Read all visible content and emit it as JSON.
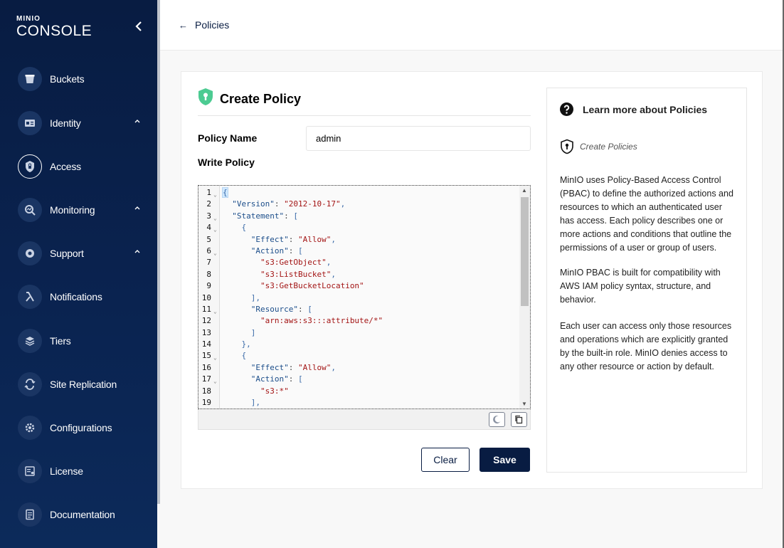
{
  "app": {
    "logo_top": "MINIO",
    "logo_main": "CONSOLE"
  },
  "sidebar": {
    "items": [
      {
        "label": "Buckets",
        "icon": "bucket-icon"
      },
      {
        "label": "Identity",
        "icon": "id-card-icon",
        "expandable": true
      },
      {
        "label": "Access",
        "icon": "lock-shield-icon",
        "active": true
      },
      {
        "label": "Monitoring",
        "icon": "monitoring-icon",
        "expandable": true
      },
      {
        "label": "Support",
        "icon": "support-icon",
        "expandable": true
      },
      {
        "label": "Notifications",
        "icon": "lambda-icon"
      },
      {
        "label": "Tiers",
        "icon": "layers-icon"
      },
      {
        "label": "Site Replication",
        "icon": "replication-icon"
      },
      {
        "label": "Configurations",
        "icon": "gear-icon"
      },
      {
        "label": "License",
        "icon": "license-icon"
      },
      {
        "label": "Documentation",
        "icon": "document-icon"
      }
    ]
  },
  "header": {
    "back_label": "Policies"
  },
  "form": {
    "title": "Create Policy",
    "policy_name_label": "Policy Name",
    "policy_name_value": "admin",
    "write_policy_label": "Write Policy",
    "clear_label": "Clear",
    "save_label": "Save"
  },
  "editor": {
    "lines": [
      {
        "n": "1",
        "fold": true,
        "text": "{"
      },
      {
        "n": "2",
        "fold": false,
        "text": "  \"Version\": \"2012-10-17\","
      },
      {
        "n": "3",
        "fold": true,
        "text": "  \"Statement\": ["
      },
      {
        "n": "4",
        "fold": true,
        "text": "    {"
      },
      {
        "n": "5",
        "fold": false,
        "text": "      \"Effect\": \"Allow\","
      },
      {
        "n": "6",
        "fold": true,
        "text": "      \"Action\": ["
      },
      {
        "n": "7",
        "fold": false,
        "text": "        \"s3:GetObject\","
      },
      {
        "n": "8",
        "fold": false,
        "text": "        \"s3:ListBucket\","
      },
      {
        "n": "9",
        "fold": false,
        "text": "        \"s3:GetBucketLocation\""
      },
      {
        "n": "10",
        "fold": false,
        "text": "      ],"
      },
      {
        "n": "11",
        "fold": true,
        "text": "      \"Resource\": ["
      },
      {
        "n": "12",
        "fold": false,
        "text": "        \"arn:aws:s3:::attribute/*\""
      },
      {
        "n": "13",
        "fold": false,
        "text": "      ]"
      },
      {
        "n": "14",
        "fold": false,
        "text": "    },"
      },
      {
        "n": "15",
        "fold": true,
        "text": "    {"
      },
      {
        "n": "16",
        "fold": false,
        "text": "      \"Effect\": \"Allow\","
      },
      {
        "n": "17",
        "fold": true,
        "text": "      \"Action\": ["
      },
      {
        "n": "18",
        "fold": false,
        "text": "        \"s3:*\""
      },
      {
        "n": "19",
        "fold": false,
        "text": "      ],"
      }
    ]
  },
  "help": {
    "title": "Learn more about Policies",
    "link_label": "Create Policies",
    "paragraphs": [
      "MinIO uses Policy-Based Access Control (PBAC) to define the authorized actions and resources to which an authenticated user has access. Each policy describes one or more actions and conditions that outline the permissions of a user or group of users.",
      "MinIO PBAC is built for compatibility with AWS IAM policy syntax, structure, and behavior.",
      "Each user can access only those resources and operations which are explicitly granted by the built-in role. MinIO denies access to any other resource or action by default."
    ]
  }
}
